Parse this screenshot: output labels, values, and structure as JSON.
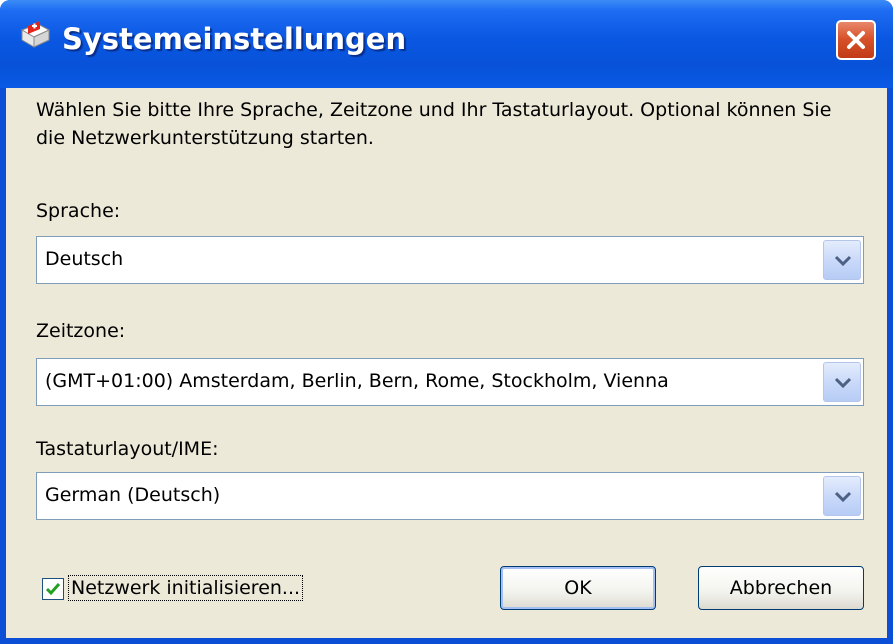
{
  "window": {
    "title": "Systemeinstellungen",
    "close_icon": "close-icon",
    "app_icon": "flag-settings-icon"
  },
  "intro_text": "Wählen Sie bitte Ihre Sprache, Zeitzone und Ihr Tastaturlayout. Optional können Sie die Netzwerkunterstützung starten.",
  "language": {
    "label": "Sprache:",
    "value": "Deutsch"
  },
  "timezone": {
    "label": "Zeitzone:",
    "value": "(GMT+01:00) Amsterdam, Berlin, Bern, Rome, Stockholm, Vienna"
  },
  "keyboard": {
    "label": "Tastaturlayout/IME:",
    "value": "German (Deutsch)"
  },
  "network": {
    "label": "Netzwerk initialisieren...",
    "checked": true
  },
  "buttons": {
    "ok": "OK",
    "cancel": "Abbrechen"
  },
  "colors": {
    "titlebar": "#0a57e2",
    "close_button": "#d8532c",
    "dialog_background": "#ece9d8",
    "checkmark": "#21a121"
  }
}
